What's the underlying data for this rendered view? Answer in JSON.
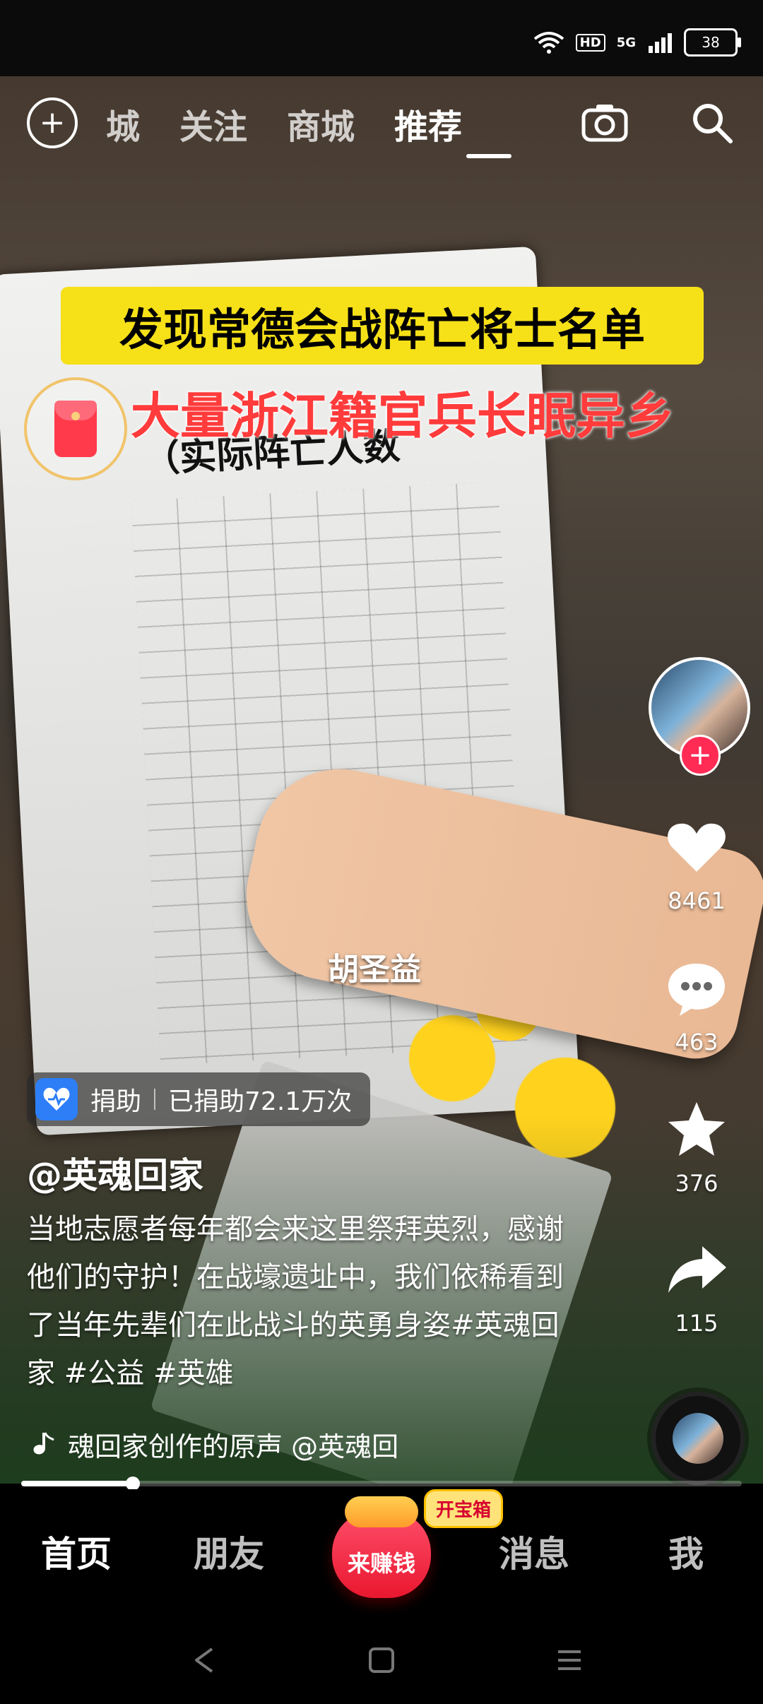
{
  "status_bar": {
    "hd": "HD",
    "network": "5G",
    "battery": "38"
  },
  "top_nav": {
    "tabs": [
      "城",
      "关注",
      "商城",
      "推荐"
    ],
    "active_tab": "推荐"
  },
  "video": {
    "caption_yellow": "发现常德会战阵亡将士名单",
    "caption_red": "大量浙江籍官兵长眠异乡",
    "paper_heading": "（实际阵亡人数",
    "overlay_name": "胡圣益"
  },
  "sidebar": {
    "likes": "8461",
    "comments": "463",
    "favorites": "376",
    "shares": "115"
  },
  "donation": {
    "label": "捐助",
    "count_text": "已捐助72.1万次"
  },
  "post": {
    "author": "@英魂回家",
    "description": "当地志愿者每年都会来这里祭拜英烈，感谢他们的守护！在战壕遗址中，我们依稀看到了当年先辈们在此战斗的英勇身姿#英魂回家 #公益 #英雄"
  },
  "music": {
    "text": "魂回家创作的原声    @英魂回"
  },
  "playback": {
    "progress_fraction": 0.155
  },
  "bottom_nav": {
    "items": [
      "首页",
      "朋友",
      "消息",
      "我"
    ],
    "earn_label": "来赚钱",
    "treasure_label": "开宝箱"
  }
}
